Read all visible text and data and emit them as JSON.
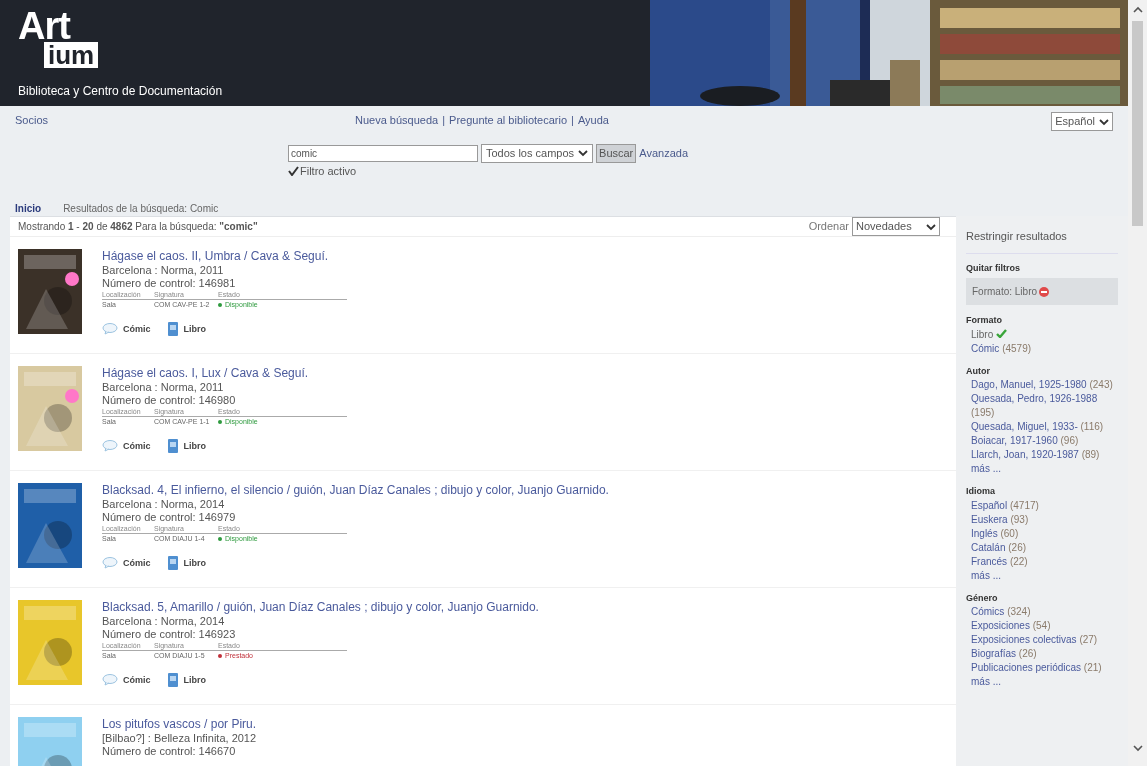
{
  "header": {
    "logo_top": "Art",
    "logo_bottom": "ium",
    "subtitle": "Biblioteca y Centro de Documentación",
    "banner": {
      "kind": "picture"
    }
  },
  "nav": {
    "left_link": "Socios",
    "links": [
      "Nueva búsqueda",
      "Pregunte al bibliotecario",
      "Ayuda"
    ],
    "separator": "|",
    "language": "Español"
  },
  "search": {
    "value": "comic",
    "scope": "Todos los campos",
    "button": "Buscar",
    "advanced": "Avanzada",
    "filter": {
      "label": "Filtro activo",
      "checked": true
    }
  },
  "breadcrumb": [
    "Inicio",
    "Resultados de la búsqueda: Comic"
  ],
  "summary": "Mostrando **1** - **20** de **4862** Para la búsqueda: **\"comic\"**",
  "sort": {
    "label": "Ordenar",
    "value": "Novedades"
  },
  "results": [
    {
      "title": "Hágase el caos. II, Umbra / Cava & Seguí.",
      "imprint": "Barcelona : Norma, 2011",
      "control": "Número de control: 146981",
      "holdings_columns": [
        "Localización",
        "Signatura",
        "Estado"
      ],
      "holding": {
        "location": "Sala",
        "call_number": "COM CAV-PE 1-2",
        "status": "Disponible",
        "kind": "available"
      },
      "tags": [
        "Cómic",
        "Libro"
      ],
      "cover": {
        "kind": "picture"
      }
    },
    {
      "title": "Hágase el caos. I, Lux / Cava & Seguí.",
      "imprint": "Barcelona : Norma, 2011",
      "control": "Número de control: 146980",
      "holdings_columns": [
        "Localización",
        "Signatura",
        "Estado"
      ],
      "holding": {
        "location": "Sala",
        "call_number": "COM CAV-PE 1-1",
        "status": "Disponible",
        "kind": "available"
      },
      "tags": [
        "Cómic",
        "Libro"
      ],
      "cover": {
        "kind": "picture"
      }
    },
    {
      "title": "Blacksad. 4, El infierno, el silencio / guión, Juan Díaz Canales ; dibujo y color, Juanjo Guarnido.",
      "imprint": "Barcelona : Norma, 2014",
      "control": "Número de control: 146979",
      "holdings_columns": [
        "Localización",
        "Signatura",
        "Estado"
      ],
      "holding": {
        "location": "Sala",
        "call_number": "COM DIAJU 1-4",
        "status": "Disponible",
        "kind": "available"
      },
      "tags": [
        "Cómic",
        "Libro"
      ],
      "cover": {
        "kind": "picture"
      }
    },
    {
      "title": "Blacksad. 5, Amarillo / guión, Juan Díaz Canales ; dibujo y color, Juanjo Guarnido.",
      "imprint": "Barcelona : Norma, 2014",
      "control": "Número de control: 146923",
      "holdings_columns": [
        "Localización",
        "Signatura",
        "Estado"
      ],
      "holding": {
        "location": "Sala",
        "call_number": "COM DIAJU 1-5",
        "status": "Prestado",
        "kind": "loaned"
      },
      "tags": [
        "Cómic",
        "Libro"
      ],
      "cover": {
        "kind": "picture"
      }
    },
    {
      "title": "Los pitufos vascos / por Piru.",
      "imprint": "[Bilbao?] : Belleza Infinita, 2012",
      "control": "Número de control: 146670",
      "cover": {
        "kind": "picture"
      }
    }
  ],
  "sidebar": {
    "title": "Restringir resultados",
    "remove_filters": {
      "heading": "Quitar filtros",
      "active": "Formato: Libro"
    },
    "facets": [
      {
        "heading": "Formato",
        "items": [
          {
            "label": "Libro",
            "selected": true
          },
          {
            "label": "Cómic",
            "count": "(4579)",
            "selected": false
          }
        ]
      },
      {
        "heading": "Autor",
        "items": [
          {
            "label": "Dago, Manuel, 1925-1980",
            "count": "(243)",
            "selected": false
          },
          {
            "label": "Quesada, Pedro, 1926-1988",
            "count": "(195)",
            "selected": false
          },
          {
            "label": "Quesada, Miguel, 1933-",
            "count": "(116)",
            "selected": false
          },
          {
            "label": "Boiacar, 1917-1960",
            "count": "(96)",
            "selected": false
          },
          {
            "label": "Llarch, Joan, 1920-1987",
            "count": "(89)",
            "selected": false
          }
        ],
        "more": "más ..."
      },
      {
        "heading": "Idioma",
        "items": [
          {
            "label": "Español",
            "count": "(4717)",
            "selected": false
          },
          {
            "label": "Euskera",
            "count": "(93)",
            "selected": false
          },
          {
            "label": "Inglés",
            "count": "(60)",
            "selected": false
          },
          {
            "label": "Catalán",
            "count": "(26)",
            "selected": false
          },
          {
            "label": "Francés",
            "count": "(22)",
            "selected": false
          }
        ],
        "more": "más ..."
      },
      {
        "heading": "Género",
        "items": [
          {
            "label": "Cómics",
            "count": "(324)",
            "selected": false
          },
          {
            "label": "Exposiciones",
            "count": "(54)",
            "selected": false
          },
          {
            "label": "Exposiciones colectivas",
            "count": "(27)",
            "selected": false
          },
          {
            "label": "Biografías",
            "count": "(26)",
            "selected": false
          },
          {
            "label": "Publicaciones periódicas",
            "count": "(21)",
            "selected": false
          }
        ],
        "more": "más ..."
      }
    ]
  }
}
